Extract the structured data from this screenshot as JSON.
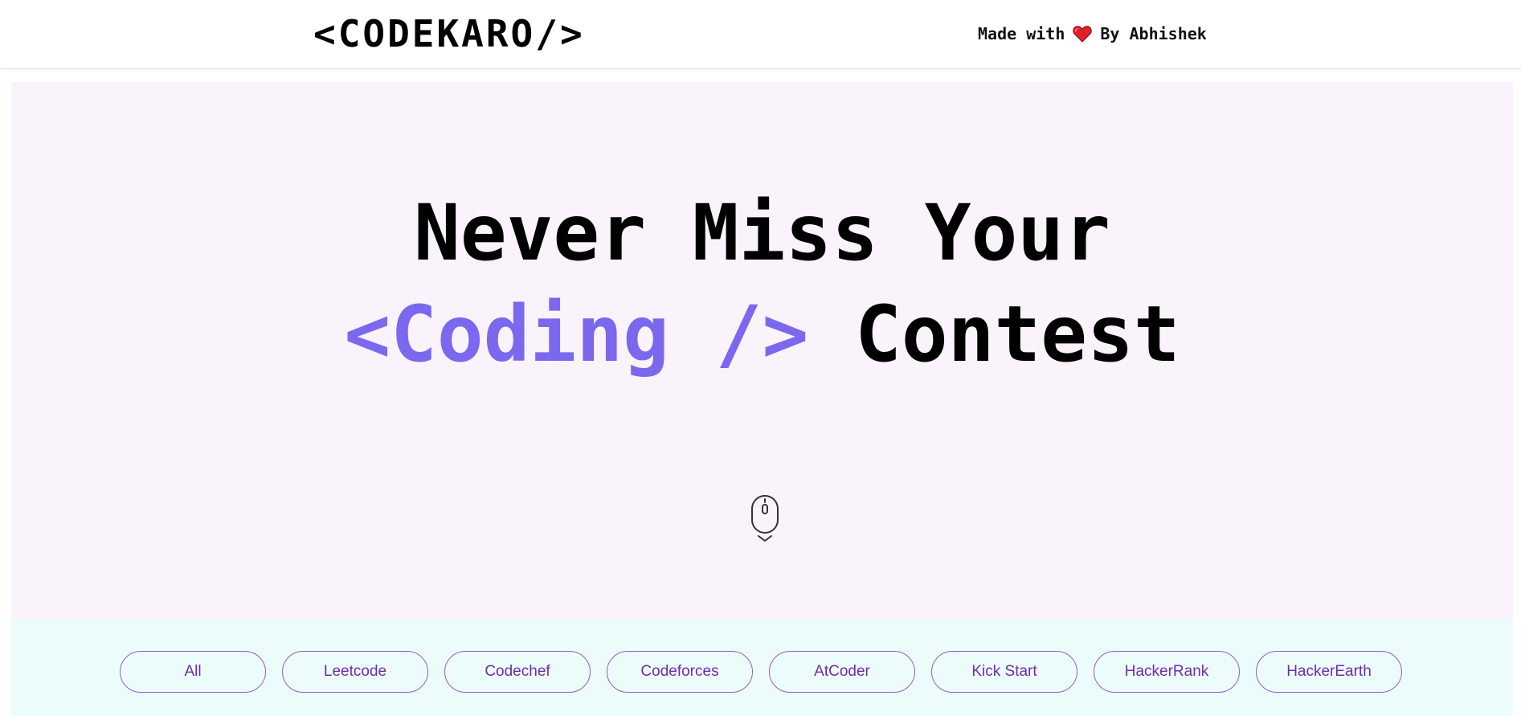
{
  "header": {
    "logo": "<CODEKARO/>",
    "credit_prefix": "Made with",
    "credit_suffix": "By Abhishek",
    "heart_icon": "heart-icon",
    "heart_color": "#e0202a"
  },
  "hero": {
    "line1": "Never Miss Your",
    "line2_accent": "<Coding />",
    "line2_rest": " Contest",
    "accent_color": "#7b68ee",
    "scroll_icon": "mouse-scroll-icon"
  },
  "filters": {
    "items": [
      {
        "label": "All"
      },
      {
        "label": "Leetcode"
      },
      {
        "label": "Codechef"
      },
      {
        "label": "Codeforces"
      },
      {
        "label": "AtCoder"
      },
      {
        "label": "Kick Start"
      },
      {
        "label": "HackerRank"
      },
      {
        "label": "HackerEarth"
      }
    ]
  }
}
